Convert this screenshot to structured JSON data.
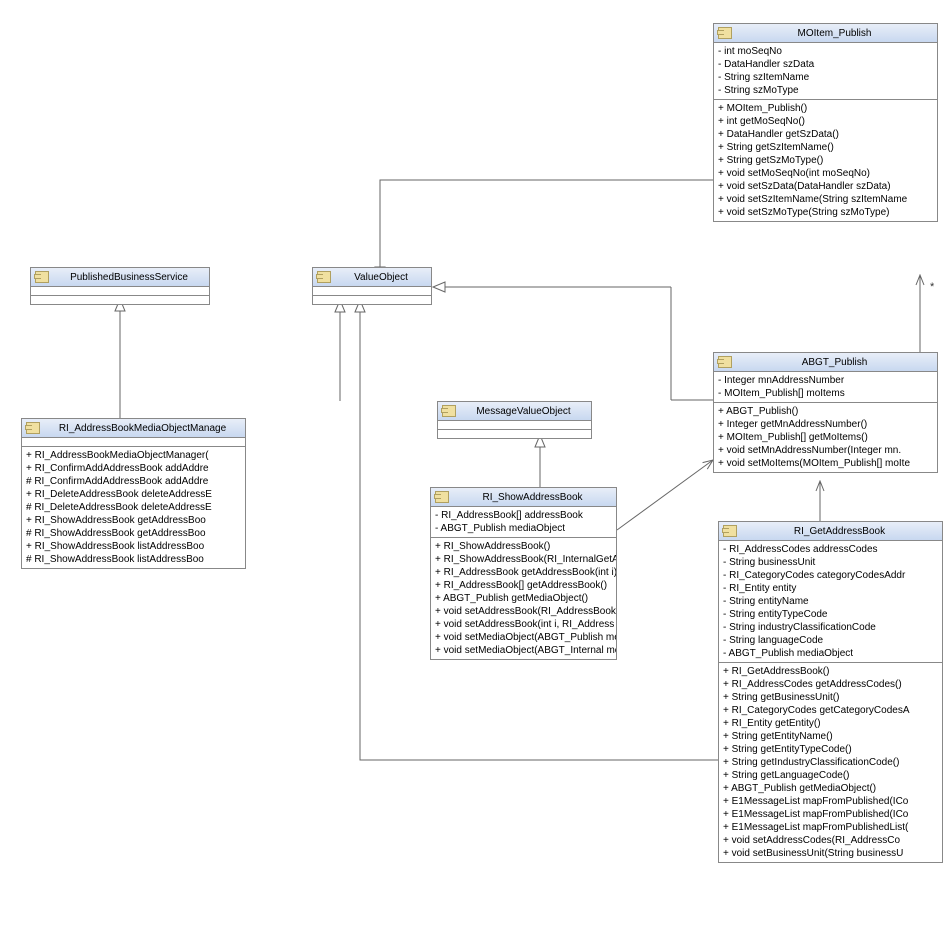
{
  "classes": {
    "publishedBusinessService": {
      "name": "PublishedBusinessService",
      "attributes": [],
      "methods": []
    },
    "valueObject": {
      "name": "ValueObject",
      "attributes": [],
      "methods": []
    },
    "messageValueObject": {
      "name": "MessageValueObject",
      "attributes": [],
      "methods": []
    },
    "riAddressBookMediaObjectManager": {
      "name": "RI_AddressBookMediaObjectManage",
      "attributes": [],
      "methods": [
        "+ RI_AddressBookMediaObjectManager(",
        "+ RI_ConfirmAddAddressBook addAddre",
        "# RI_ConfirmAddAddressBook addAddre",
        "+ RI_DeleteAddressBook deleteAddressE",
        "# RI_DeleteAddressBook deleteAddressE",
        "+ RI_ShowAddressBook getAddressBoo",
        "# RI_ShowAddressBook getAddressBoo",
        "+ RI_ShowAddressBook listAddressBoo",
        "# RI_ShowAddressBook listAddressBoo"
      ]
    },
    "riShowAddressBook": {
      "name": "RI_ShowAddressBook",
      "attributes": [
        "- RI_AddressBook[] addressBook",
        "- ABGT_Publish mediaObject"
      ],
      "methods": [
        "+ RI_ShowAddressBook()",
        "+ RI_ShowAddressBook(RI_InternalGetA",
        "+ RI_AddressBook getAddressBook(int i)",
        "+ RI_AddressBook[] getAddressBook()",
        "+ ABGT_Publish getMediaObject()",
        "+ void setAddressBook(RI_AddressBook",
        "+ void setAddressBook(int i, RI_Address",
        "+ void setMediaObject(ABGT_Publish me",
        "+ void setMediaObject(ABGT_Internal me"
      ]
    },
    "moItemPublish": {
      "name": "MOItem_Publish",
      "attributes": [
        "- int moSeqNo",
        "- DataHandler szData",
        "- String szItemName",
        "- String szMoType"
      ],
      "methods": [
        "+ MOItem_Publish()",
        "+ int getMoSeqNo()",
        "+ DataHandler getSzData()",
        "+ String getSzItemName()",
        "+ String getSzMoType()",
        "+ void setMoSeqNo(int moSeqNo)",
        "+ void setSzData(DataHandler szData)",
        "+ void setSzItemName(String szItemName",
        "+ void setSzMoType(String szMoType)"
      ]
    },
    "abgtPublish": {
      "name": "ABGT_Publish",
      "attributes": [
        "- Integer mnAddressNumber",
        "- MOItem_Publish[] moItems"
      ],
      "methods": [
        "+ ABGT_Publish()",
        "+ Integer getMnAddressNumber()",
        "+ MOItem_Publish[] getMoItems()",
        "+ void setMnAddressNumber(Integer mn.",
        "+ void setMoItems(MOItem_Publish[] moIte"
      ]
    },
    "riGetAddressBook": {
      "name": "RI_GetAddressBook",
      "attributes": [
        "- RI_AddressCodes addressCodes",
        "- String businessUnit",
        "- RI_CategoryCodes categoryCodesAddr",
        "- RI_Entity entity",
        "- String entityName",
        "- String entityTypeCode",
        "- String industryClassificationCode",
        "- String languageCode",
        "- ABGT_Publish mediaObject"
      ],
      "methods": [
        "+ RI_GetAddressBook()",
        "+ RI_AddressCodes getAddressCodes()",
        "+ String getBusinessUnit()",
        "+ RI_CategoryCodes getCategoryCodesA",
        "+ RI_Entity getEntity()",
        "+ String getEntityName()",
        "+ String getEntityTypeCode()",
        "+ String getIndustryClassificationCode()",
        "+ String getLanguageCode()",
        "+ ABGT_Publish getMediaObject()",
        "+ E1MessageList mapFromPublished(ICo",
        "+ E1MessageList mapFromPublished(ICo",
        "+ E1MessageList mapFromPublishedList(",
        "+ void setAddressCodes(RI_AddressCo",
        "+ void setBusinessUnit(String businessU"
      ]
    }
  },
  "multiplicity": "*"
}
